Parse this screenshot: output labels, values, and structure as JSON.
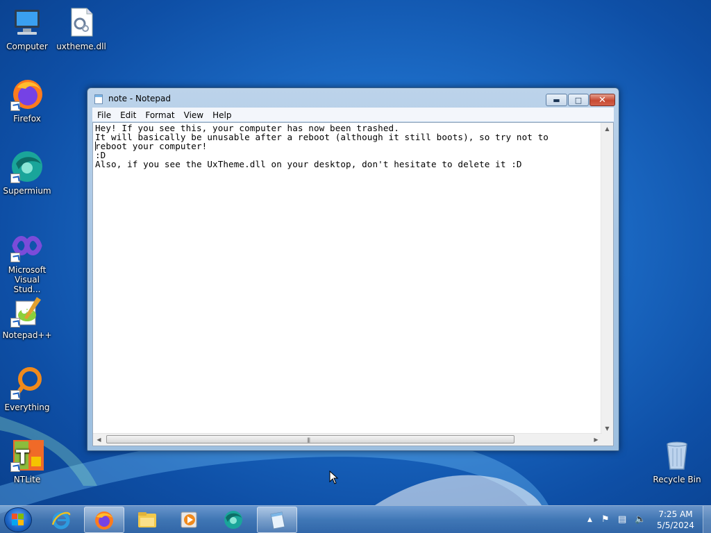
{
  "desktop": {
    "icons": [
      {
        "label": "Computer",
        "icon": "computer-icon"
      },
      {
        "label": "uxtheme.dll",
        "icon": "dll-file-icon"
      },
      {
        "label": "Firefox",
        "icon": "firefox-icon"
      },
      {
        "label": "Supermium",
        "icon": "supermium-icon"
      },
      {
        "label": "Microsoft Visual Stud...",
        "icon": "visual-studio-icon"
      },
      {
        "label": "Notepad++",
        "icon": "notepad-plus-plus-icon"
      },
      {
        "label": "Everything",
        "icon": "everything-search-icon"
      },
      {
        "label": "NTLite",
        "icon": "ntlite-icon"
      },
      {
        "label": "Recycle Bin",
        "icon": "recycle-bin-icon"
      }
    ]
  },
  "window": {
    "title": "note - Notepad",
    "menu": [
      "File",
      "Edit",
      "Format",
      "View",
      "Help"
    ],
    "content": "Hey! If you see this, your computer has now been trashed.\nIt will basically be unusable after a reboot (although it still boots), so try not to\nreboot your computer!\n:D\nAlso, if you see the UxTheme.dll on your desktop, don't hesitate to delete it :D"
  },
  "taskbar": {
    "items": [
      "internet-explorer-icon",
      "firefox-icon",
      "windows-explorer-icon",
      "media-player-icon",
      "supermium-icon",
      "notepad-icon"
    ],
    "active_item": "notepad-icon",
    "clock_time": "7:25 AM",
    "clock_date": "5/5/2024"
  },
  "colors": {
    "desktop_bg": "#1d6dc8",
    "window_frame": "#a8c6e4",
    "close_button": "#c74a33"
  }
}
